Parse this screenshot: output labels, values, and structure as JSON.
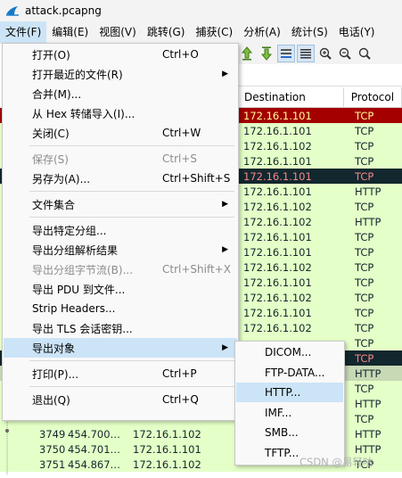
{
  "window": {
    "title": "attack.pcapng"
  },
  "menubar": [
    {
      "label": "文件(F)",
      "active": true
    },
    {
      "label": "编辑(E)"
    },
    {
      "label": "视图(V)"
    },
    {
      "label": "跳转(G)"
    },
    {
      "label": "捕获(C)"
    },
    {
      "label": "分析(A)"
    },
    {
      "label": "统计(S)"
    },
    {
      "label": "电话(Y)"
    }
  ],
  "toolbar_icons": [
    "jump-up-icon",
    "jump-down-icon",
    "autoscroll-icon",
    "colorize-icon",
    "zoom-in-icon",
    "zoom-out-icon",
    "zoom-reset-icon"
  ],
  "packet_list": {
    "headers": {
      "destination": "Destination",
      "protocol": "Protocol"
    },
    "rows": [
      {
        "no": "",
        "time": "",
        "src": "",
        "dst": "172.16.1.101",
        "proto": "TCP",
        "bg": "#a40000",
        "fg": "#fffc9c"
      },
      {
        "no": "",
        "time": "",
        "src": "",
        "dst": "172.16.1.101",
        "proto": "TCP",
        "bg": "#e4ffc7",
        "fg": "#12272e"
      },
      {
        "no": "",
        "time": "",
        "src": "",
        "dst": "172.16.1.102",
        "proto": "TCP",
        "bg": "#e4ffc7",
        "fg": "#12272e"
      },
      {
        "no": "",
        "time": "",
        "src": "",
        "dst": "172.16.1.101",
        "proto": "TCP",
        "bg": "#e4ffc7",
        "fg": "#12272e"
      },
      {
        "no": "",
        "time": "",
        "src": "",
        "dst": "172.16.1.101",
        "proto": "TCP",
        "bg": "#12272e",
        "fg": "#f78787"
      },
      {
        "no": "",
        "time": "",
        "src": "",
        "dst": "172.16.1.101",
        "proto": "HTTP",
        "bg": "#e4ffc7",
        "fg": "#12272e"
      },
      {
        "no": "",
        "time": "",
        "src": "",
        "dst": "172.16.1.102",
        "proto": "TCP",
        "bg": "#e4ffc7",
        "fg": "#12272e"
      },
      {
        "no": "",
        "time": "",
        "src": "",
        "dst": "172.16.1.102",
        "proto": "HTTP",
        "bg": "#e4ffc7",
        "fg": "#12272e"
      },
      {
        "no": "",
        "time": "",
        "src": "",
        "dst": "172.16.1.101",
        "proto": "TCP",
        "bg": "#e4ffc7",
        "fg": "#12272e"
      },
      {
        "no": "",
        "time": "",
        "src": "",
        "dst": "172.16.1.101",
        "proto": "TCP",
        "bg": "#e4ffc7",
        "fg": "#12272e"
      },
      {
        "no": "",
        "time": "",
        "src": "",
        "dst": "172.16.1.102",
        "proto": "TCP",
        "bg": "#e4ffc7",
        "fg": "#12272e"
      },
      {
        "no": "",
        "time": "",
        "src": "",
        "dst": "172.16.1.101",
        "proto": "TCP",
        "bg": "#e4ffc7",
        "fg": "#12272e"
      },
      {
        "no": "",
        "time": "",
        "src": "",
        "dst": "172.16.1.102",
        "proto": "TCP",
        "bg": "#e4ffc7",
        "fg": "#12272e"
      },
      {
        "no": "",
        "time": "",
        "src": "",
        "dst": "172.16.1.101",
        "proto": "TCP",
        "bg": "#e4ffc7",
        "fg": "#12272e"
      },
      {
        "no": "",
        "time": "",
        "src": "",
        "dst": "172.16.1.102",
        "proto": "TCP",
        "bg": "#e4ffc7",
        "fg": "#12272e"
      },
      {
        "no": "",
        "time": "",
        "src": "",
        "dst": "",
        "proto": "TCP",
        "bg": "#e4ffc7",
        "fg": "#12272e"
      },
      {
        "no": "",
        "time": "",
        "src": "",
        "dst": "",
        "proto": "TCP",
        "bg": "#12272e",
        "fg": "#f78787"
      },
      {
        "no": "",
        "time": "",
        "src": "",
        "dst": "",
        "proto": "HTTP",
        "bg": "#c7d9b5",
        "fg": "#12272e"
      },
      {
        "no": "",
        "time": "",
        "src": "",
        "dst": "",
        "proto": "TCP",
        "bg": "#e4ffc7",
        "fg": "#12272e"
      },
      {
        "no": "",
        "time": "",
        "src": "",
        "dst": "",
        "proto": "HTTP",
        "bg": "#e4ffc7",
        "fg": "#12272e"
      },
      {
        "no": "",
        "time": "",
        "src": "",
        "dst": "",
        "proto": "TCP",
        "bg": "#e4ffc7",
        "fg": "#12272e"
      },
      {
        "no": "3749",
        "time": "454.700…",
        "src": "172.16.1.102",
        "dst": "",
        "proto": "HTTP",
        "bg": "#e4ffc7",
        "fg": "#12272e"
      },
      {
        "no": "3750",
        "time": "454.701…",
        "src": "172.16.1.101",
        "dst": "",
        "proto": "HTTP",
        "bg": "#e4ffc7",
        "fg": "#12272e"
      },
      {
        "no": "3751",
        "time": "454.867…",
        "src": "172.16.1.102",
        "dst": "",
        "proto": "TCP",
        "bg": "#e4ffc7",
        "fg": "#12272e"
      }
    ]
  },
  "file_menu": {
    "items": [
      {
        "label": "打开(O)",
        "shortcut": "Ctrl+O"
      },
      {
        "label": "打开最近的文件(R)",
        "submenu": true
      },
      {
        "label": "合并(M)..."
      },
      {
        "label": "从 Hex 转储导入(I)..."
      },
      {
        "label": "关闭(C)",
        "shortcut": "Ctrl+W"
      },
      {
        "sep": true
      },
      {
        "label": "保存(S)",
        "shortcut": "Ctrl+S",
        "disabled": true
      },
      {
        "label": "另存为(A)...",
        "shortcut": "Ctrl+Shift+S"
      },
      {
        "sep": true
      },
      {
        "label": "文件集合",
        "submenu": true
      },
      {
        "sep": true
      },
      {
        "label": "导出特定分组..."
      },
      {
        "label": "导出分组解析结果",
        "submenu": true
      },
      {
        "label": "导出分组字节流(B)...",
        "shortcut": "Ctrl+Shift+X",
        "disabled": true
      },
      {
        "label": "导出 PDU 到文件..."
      },
      {
        "label": "Strip Headers..."
      },
      {
        "label": "导出 TLS 会话密钥..."
      },
      {
        "label": "导出对象",
        "submenu": true,
        "highlight": true
      },
      {
        "sep": true
      },
      {
        "label": "打印(P)...",
        "shortcut": "Ctrl+P"
      },
      {
        "sep": true
      },
      {
        "label": "退出(Q)",
        "shortcut": "Ctrl+Q"
      }
    ]
  },
  "export_objects_menu": {
    "items": [
      {
        "label": "DICOM..."
      },
      {
        "label": "FTP-DATA..."
      },
      {
        "label": "HTTP...",
        "highlight": true
      },
      {
        "label": "IMF..."
      },
      {
        "label": "SMB..."
      },
      {
        "label": "TFTP..."
      }
    ]
  },
  "watermark": "CSDN @易轻咕"
}
